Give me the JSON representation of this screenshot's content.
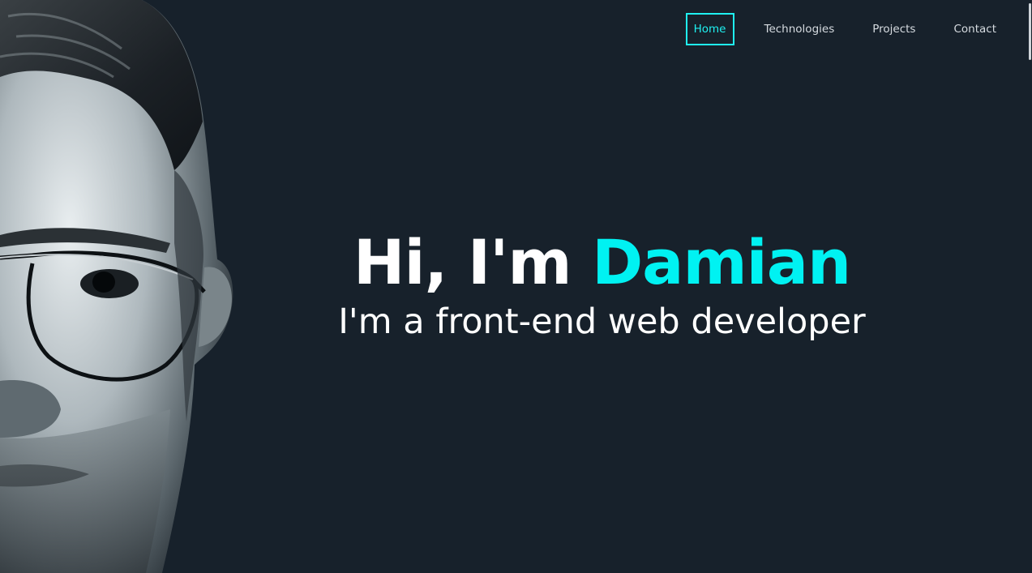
{
  "nav": {
    "items": [
      {
        "label": "Home",
        "active": true
      },
      {
        "label": "Technologies",
        "active": false
      },
      {
        "label": "Projects",
        "active": false
      },
      {
        "label": "Contact",
        "active": false
      }
    ]
  },
  "hero": {
    "greeting": "Hi, I'm ",
    "name": "Damian",
    "subtitle": "I'm a front-end web developer"
  },
  "colors": {
    "background": "#17212b",
    "accent": "#00f2f2",
    "text": "#ffffff"
  },
  "portrait": {
    "icon": "portrait-photo"
  }
}
